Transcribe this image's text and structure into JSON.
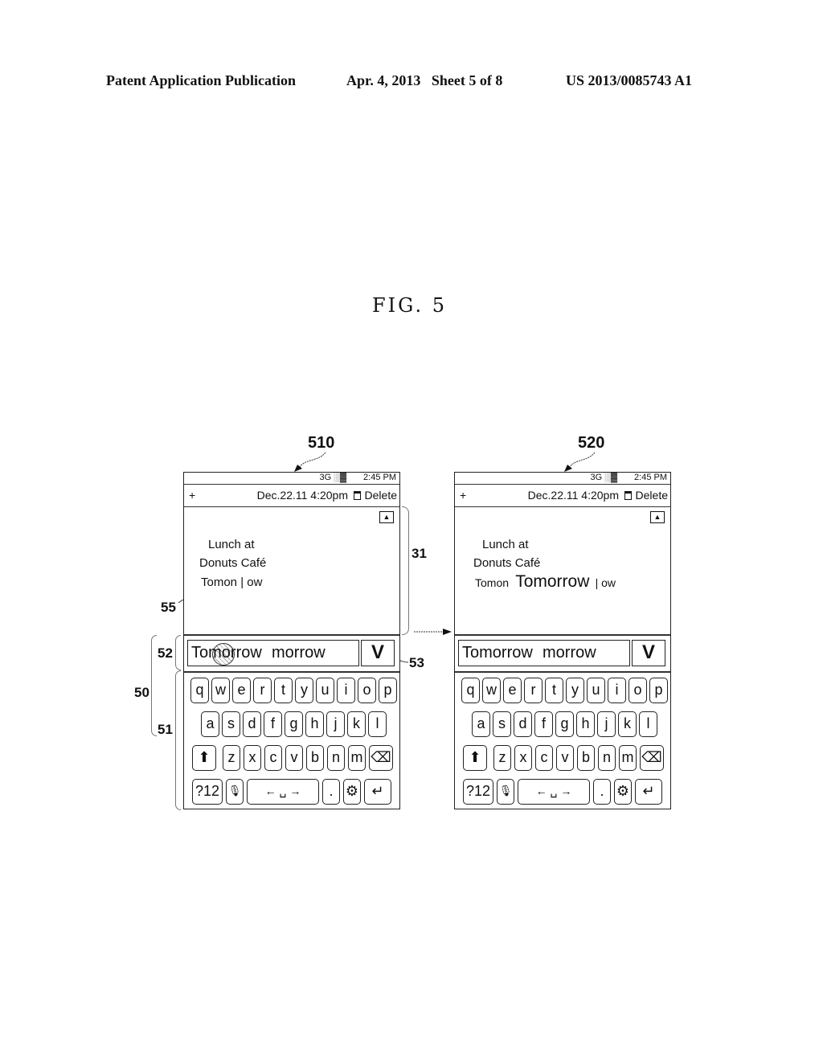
{
  "header": {
    "left": "Patent Application Publication",
    "middle": "Apr. 4, 2013   Sheet 5 of 8",
    "right": "US 2013/0085743 A1"
  },
  "figure_label": "FIG. 5",
  "refs": {
    "screen_a": "510",
    "screen_b": "520",
    "memo_area": "31",
    "touch_point": "55",
    "keypad": "50",
    "candidate_bar": "52",
    "key_area": "51",
    "confirm_button": "53"
  },
  "screens": [
    {
      "status": {
        "network": "3G ░▓",
        "time": "2:45 PM"
      },
      "titlebar": {
        "add": "+",
        "date": "Dec.22.11 4:20pm",
        "delete": "Delete"
      },
      "memo_lines": [
        "Lunch at",
        "Donuts Café",
        "Tomon | ow"
      ],
      "memo_inserted": "",
      "candidates": [
        "Tomorrow",
        "morrow"
      ],
      "confirm": "V",
      "touch_indicator": true
    },
    {
      "status": {
        "network": "3G ░▓",
        "time": "2:45 PM"
      },
      "titlebar": {
        "add": "+",
        "date": "Dec.22.11 4:20pm",
        "delete": "Delete"
      },
      "memo_lines": [
        "Lunch at",
        "Donuts Café",
        "Tomon"
      ],
      "memo_inserted": "Tomorrow",
      "memo_tail": "| ow",
      "candidates": [
        "Tomorrow",
        "morrow"
      ],
      "confirm": "V",
      "touch_indicator": false
    }
  ],
  "keyboard": {
    "row1": [
      "q",
      "w",
      "e",
      "r",
      "t",
      "y",
      "u",
      "i",
      "o",
      "p"
    ],
    "row2": [
      "a",
      "s",
      "d",
      "f",
      "g",
      "h",
      "j",
      "k",
      "l"
    ],
    "row3": [
      "⬆",
      "z",
      "x",
      "c",
      "v",
      "b",
      "n",
      "m",
      "⌫"
    ],
    "row4": [
      "?12",
      "🎙",
      "← ␣ →",
      ".",
      "⚙",
      "↵"
    ],
    "row4_names": [
      "symbols-key",
      "mic-key",
      "space-key",
      "period-key",
      "settings-key",
      "enter-key"
    ]
  }
}
